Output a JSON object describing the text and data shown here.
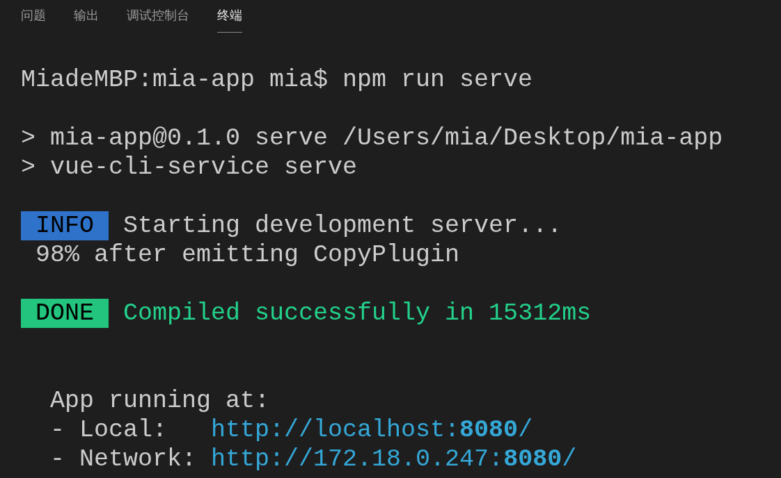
{
  "tabs": [
    {
      "label": "问题",
      "selected": false
    },
    {
      "label": "输出",
      "selected": false
    },
    {
      "label": "调试控制台",
      "selected": false
    },
    {
      "label": "终端",
      "selected": true
    }
  ],
  "terminal": {
    "lines": [
      {
        "kind": "line",
        "segments": [
          {
            "kind": "text",
            "text": "MiadeMBP:mia-app mia$ npm run serve"
          }
        ]
      },
      {
        "kind": "blank"
      },
      {
        "kind": "line",
        "segments": [
          {
            "kind": "text",
            "text": "> mia-app@0.1.0 serve /Users/mia/Desktop/mia-app"
          }
        ]
      },
      {
        "kind": "line",
        "segments": [
          {
            "kind": "text",
            "text": "> vue-cli-service serve"
          }
        ]
      },
      {
        "kind": "blank"
      },
      {
        "kind": "line",
        "segments": [
          {
            "kind": "badge",
            "text": " INFO ",
            "color": "#2f72c9"
          },
          {
            "kind": "text",
            "text": " Starting development server..."
          }
        ]
      },
      {
        "kind": "line",
        "segments": [
          {
            "kind": "text",
            "text": " 98% after emitting CopyPlugin"
          }
        ]
      },
      {
        "kind": "blank"
      },
      {
        "kind": "line",
        "segments": [
          {
            "kind": "badge",
            "text": " DONE ",
            "color": "#23c47e"
          },
          {
            "kind": "success",
            "text": " Compiled successfully in 15312ms"
          }
        ]
      },
      {
        "kind": "blank"
      },
      {
        "kind": "blank"
      },
      {
        "kind": "line",
        "segments": [
          {
            "kind": "text",
            "text": "  App running at:"
          }
        ]
      },
      {
        "kind": "line",
        "segments": [
          {
            "kind": "text",
            "text": "  - Local:   "
          },
          {
            "kind": "link",
            "text": "http://localhost:**8080**/"
          }
        ]
      },
      {
        "kind": "line",
        "segments": [
          {
            "kind": "text",
            "text": "  - Network: "
          },
          {
            "kind": "link",
            "text": "http://172.18.0.247:**8080**/"
          }
        ]
      }
    ]
  }
}
